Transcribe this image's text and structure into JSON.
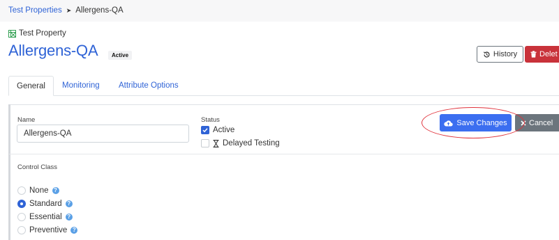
{
  "breadcrumb": {
    "parent": "Test Properties",
    "separator": "➤",
    "current": "Allergens-QA"
  },
  "entity_type": {
    "label": "Test Property",
    "icon": "property-grid-icon",
    "icon_color": "#2e9e4f"
  },
  "header": {
    "title": "Allergens-QA",
    "status_badge": "Active",
    "history_label": "History",
    "delete_label": "Delet",
    "history_icon": "history-icon",
    "delete_icon": "trash-icon",
    "delete_color": "#c9323a"
  },
  "tabs": [
    {
      "label": "General",
      "active": true
    },
    {
      "label": "Monitoring",
      "active": false
    },
    {
      "label": "Attribute Options",
      "active": false
    }
  ],
  "form": {
    "name_label": "Name",
    "name_value": "Allergens-QA",
    "status_label": "Status",
    "status_options": [
      {
        "label": "Active",
        "checked": true
      },
      {
        "label": "Delayed Testing",
        "checked": false,
        "icon": "hourglass-icon"
      }
    ],
    "save_label": "Save Changes",
    "save_icon": "cloud-upload-icon",
    "save_color": "#3b6ef0",
    "cancel_label": "Cancel",
    "cancel_icon": "close-icon",
    "control_class_label": "Control Class",
    "control_class_options": [
      {
        "label": "None",
        "selected": false
      },
      {
        "label": "Standard",
        "selected": true
      },
      {
        "label": "Essential",
        "selected": false
      },
      {
        "label": "Preventive",
        "selected": false
      }
    ]
  },
  "annotation": {
    "shape": "ellipse",
    "color": "#e0313a",
    "target": "save-changes-button"
  },
  "colors": {
    "link": "#2f63d6",
    "accent": "#2f63d6"
  }
}
